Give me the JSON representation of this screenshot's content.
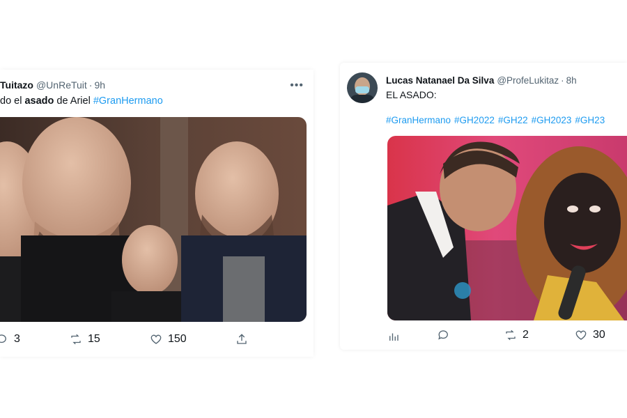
{
  "tweet_left": {
    "name": "Tuitazo",
    "handle": "@UnReTuit",
    "separator": "·",
    "time": "9h",
    "text_before": "do el ",
    "text_bold": "asado",
    "text_after": " de Ariel ",
    "hashtag": "#GranHermano",
    "more_icon": "more-horizontal-icon",
    "actions": {
      "reply_count": "3",
      "retweet_count": "15",
      "like_count": "150"
    }
  },
  "tweet_right": {
    "name": "Lucas Natanael Da Silva",
    "handle": "@ProfeLukitaz",
    "separator": "·",
    "time": "8h",
    "text": "EL ASADO:",
    "hashtags": [
      "#GranHermano",
      "#GH2022",
      "#GH22",
      "#GH2023",
      "#GH23"
    ],
    "actions": {
      "retweet_count": "2",
      "like_count": "30"
    }
  },
  "colors": {
    "link": "#1d9bf0",
    "secondary_text": "#536471",
    "primary_text": "#0f1419"
  }
}
